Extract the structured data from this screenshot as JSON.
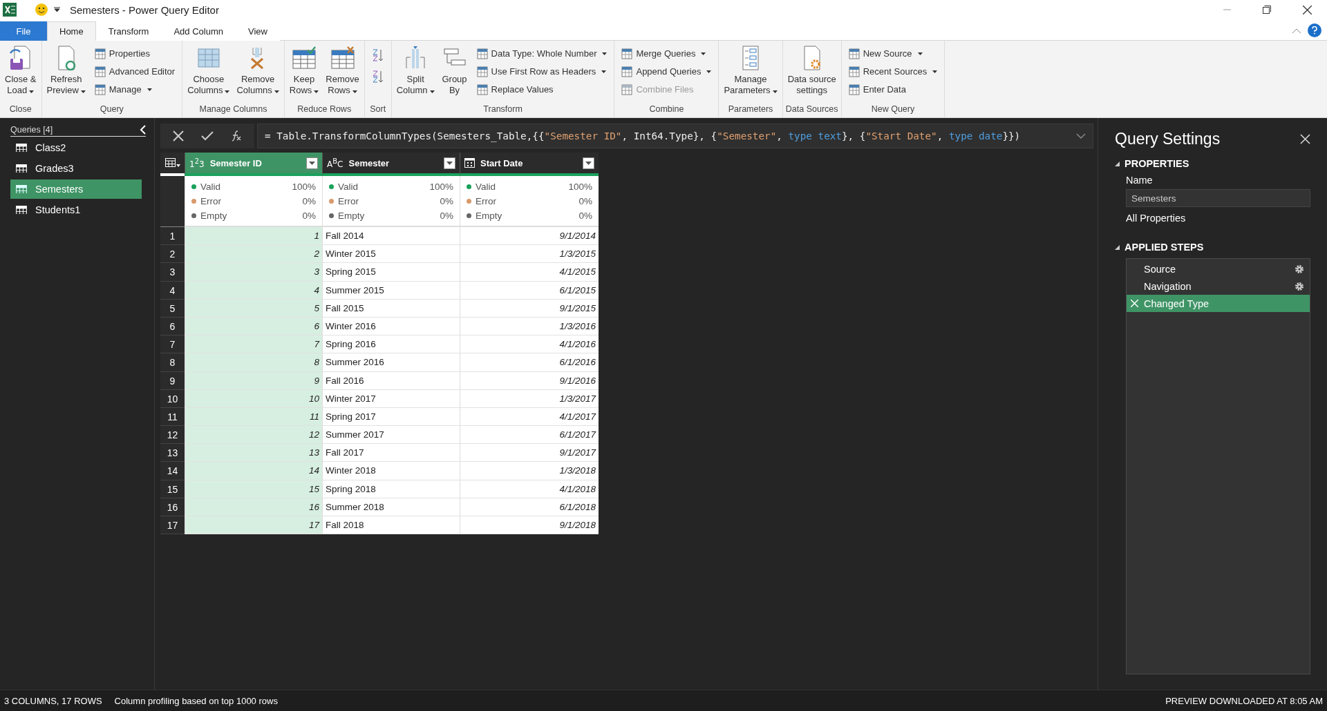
{
  "window": {
    "title": "Semesters - Power Query Editor"
  },
  "tabs": [
    {
      "label": "File",
      "kind": "file",
      "selected": false
    },
    {
      "label": "Home",
      "kind": "tab",
      "selected": true
    },
    {
      "label": "Transform",
      "kind": "tab",
      "selected": false
    },
    {
      "label": "Add Column",
      "kind": "tab",
      "selected": false
    },
    {
      "label": "View",
      "kind": "tab",
      "selected": false
    }
  ],
  "ribbon": {
    "groups": [
      {
        "label": "Close",
        "items": [
          {
            "kind": "large",
            "lines": [
              "Close &",
              "Load"
            ],
            "dropdown": true
          }
        ]
      },
      {
        "label": "Query",
        "items": [
          {
            "kind": "large",
            "lines": [
              "Refresh",
              "Preview"
            ],
            "dropdown": true
          },
          {
            "kind": "stack",
            "entries": [
              {
                "label": "Properties",
                "dropdown": false,
                "disabled": false
              },
              {
                "label": "Advanced Editor",
                "dropdown": false,
                "disabled": false
              },
              {
                "label": "Manage",
                "dropdown": true,
                "disabled": false
              }
            ]
          }
        ]
      },
      {
        "label": "Manage Columns",
        "items": [
          {
            "kind": "large",
            "lines": [
              "Choose",
              "Columns"
            ],
            "dropdown": true
          },
          {
            "kind": "large",
            "lines": [
              "Remove",
              "Columns"
            ],
            "dropdown": true
          }
        ]
      },
      {
        "label": "Reduce Rows",
        "items": [
          {
            "kind": "large",
            "lines": [
              "Keep",
              "Rows"
            ],
            "dropdown": true
          },
          {
            "kind": "large",
            "lines": [
              "Remove",
              "Rows"
            ],
            "dropdown": true
          }
        ]
      },
      {
        "label": "Sort",
        "items": [
          {
            "kind": "sort"
          }
        ]
      },
      {
        "label": "Transform",
        "items": [
          {
            "kind": "large",
            "lines": [
              "Split",
              "Column"
            ],
            "dropdown": true
          },
          {
            "kind": "large",
            "lines": [
              "Group",
              "By"
            ],
            "dropdown": false
          },
          {
            "kind": "stack",
            "entries": [
              {
                "label": "Data Type: Whole Number",
                "dropdown": true,
                "disabled": false
              },
              {
                "label": "Use First Row as Headers",
                "dropdown": true,
                "disabled": false
              },
              {
                "label": "Replace Values",
                "dropdown": false,
                "disabled": false
              }
            ]
          }
        ]
      },
      {
        "label": "Combine",
        "items": [
          {
            "kind": "stack",
            "entries": [
              {
                "label": "Merge Queries",
                "dropdown": true,
                "disabled": false
              },
              {
                "label": "Append Queries",
                "dropdown": true,
                "disabled": false
              },
              {
                "label": "Combine Files",
                "dropdown": false,
                "disabled": true
              }
            ]
          }
        ]
      },
      {
        "label": "Parameters",
        "items": [
          {
            "kind": "large",
            "lines": [
              "Manage",
              "Parameters"
            ],
            "dropdown": true
          }
        ]
      },
      {
        "label": "Data Sources",
        "items": [
          {
            "kind": "large",
            "lines": [
              "Data source",
              "settings"
            ],
            "dropdown": false
          }
        ]
      },
      {
        "label": "New Query",
        "items": [
          {
            "kind": "stack",
            "entries": [
              {
                "label": "New Source",
                "dropdown": true,
                "disabled": false
              },
              {
                "label": "Recent Sources",
                "dropdown": true,
                "disabled": false
              },
              {
                "label": "Enter Data",
                "dropdown": false,
                "disabled": false
              }
            ]
          }
        ]
      }
    ]
  },
  "queries": {
    "title": "Queries [4]",
    "items": [
      {
        "name": "Class2",
        "selected": false
      },
      {
        "name": "Grades3",
        "selected": false
      },
      {
        "name": "Semesters",
        "selected": true
      },
      {
        "name": "Students1",
        "selected": false
      }
    ]
  },
  "formula": [
    {
      "kind": "plain",
      "text": "= Table.TransformColumnTypes(Semesters_Table,{{"
    },
    {
      "kind": "string",
      "text": "\"Semester ID\""
    },
    {
      "kind": "plain",
      "text": ", Int64.Type}, {"
    },
    {
      "kind": "string",
      "text": "\"Semester\""
    },
    {
      "kind": "plain",
      "text": ", "
    },
    {
      "kind": "keyword",
      "text": "type text"
    },
    {
      "kind": "plain",
      "text": "}, {"
    },
    {
      "kind": "string",
      "text": "\"Start Date\""
    },
    {
      "kind": "plain",
      "text": ", "
    },
    {
      "kind": "keyword",
      "text": "type date"
    },
    {
      "kind": "plain",
      "text": "}})"
    }
  ],
  "table": {
    "columns": [
      {
        "name": "Semester ID",
        "kind": "number",
        "type_label": "1$^{2}$3",
        "selected": true,
        "profile": [
          {
            "label": "Valid",
            "value": "100%",
            "color": "#1aa15c"
          },
          {
            "label": "Error",
            "value": "0%",
            "color": "#d89a6a"
          },
          {
            "label": "Empty",
            "value": "0%",
            "color": "#666666"
          }
        ]
      },
      {
        "name": "Semester",
        "kind": "text",
        "type_label": "A$^{B}$C",
        "selected": false,
        "profile": [
          {
            "label": "Valid",
            "value": "100%",
            "color": "#1aa15c"
          },
          {
            "label": "Error",
            "value": "0%",
            "color": "#d89a6a"
          },
          {
            "label": "Empty",
            "value": "0%",
            "color": "#666666"
          }
        ]
      },
      {
        "name": "Start Date",
        "kind": "date",
        "selected": false,
        "profile": [
          {
            "label": "Valid",
            "value": "100%",
            "color": "#1aa15c"
          },
          {
            "label": "Error",
            "value": "0%",
            "color": "#d89a6a"
          },
          {
            "label": "Empty",
            "value": "0%",
            "color": "#666666"
          }
        ]
      }
    ],
    "rows": [
      {
        "number": "1",
        "cells": [
          "1",
          "Fall 2014",
          "9/1/2014"
        ]
      },
      {
        "number": "2",
        "cells": [
          "2",
          "Winter 2015",
          "1/3/2015"
        ]
      },
      {
        "number": "3",
        "cells": [
          "3",
          "Spring 2015",
          "4/1/2015"
        ]
      },
      {
        "number": "4",
        "cells": [
          "4",
          "Summer 2015",
          "6/1/2015"
        ]
      },
      {
        "number": "5",
        "cells": [
          "5",
          "Fall 2015",
          "9/1/2015"
        ]
      },
      {
        "number": "6",
        "cells": [
          "6",
          "Winter 2016",
          "1/3/2016"
        ]
      },
      {
        "number": "7",
        "cells": [
          "7",
          "Spring 2016",
          "4/1/2016"
        ]
      },
      {
        "number": "8",
        "cells": [
          "8",
          "Summer 2016",
          "6/1/2016"
        ]
      },
      {
        "number": "9",
        "cells": [
          "9",
          "Fall 2016",
          "9/1/2016"
        ]
      },
      {
        "number": "10",
        "cells": [
          "10",
          "Winter 2017",
          "1/3/2017"
        ]
      },
      {
        "number": "11",
        "cells": [
          "11",
          "Spring 2017",
          "4/1/2017"
        ]
      },
      {
        "number": "12",
        "cells": [
          "12",
          "Summer 2017",
          "6/1/2017"
        ]
      },
      {
        "number": "13",
        "cells": [
          "13",
          "Fall 2017",
          "9/1/2017"
        ]
      },
      {
        "number": "14",
        "cells": [
          "14",
          "Winter 2018",
          "1/3/2018"
        ]
      },
      {
        "number": "15",
        "cells": [
          "15",
          "Spring 2018",
          "4/1/2018"
        ]
      },
      {
        "number": "16",
        "cells": [
          "16",
          "Summer 2018",
          "6/1/2018"
        ]
      },
      {
        "number": "17",
        "cells": [
          "17",
          "Fall 2018",
          "9/1/2018"
        ]
      }
    ]
  },
  "settings": {
    "title": "Query Settings",
    "properties_heading": "PROPERTIES",
    "name_label": "Name",
    "name_value": "Semesters",
    "all_properties": "All Properties",
    "steps_heading": "APPLIED STEPS",
    "steps": [
      {
        "name": "Source",
        "has_settings": true,
        "selected": false
      },
      {
        "name": "Navigation",
        "has_settings": true,
        "selected": false
      },
      {
        "name": "Changed Type",
        "has_settings": false,
        "selected": true
      }
    ]
  },
  "status_bar": {
    "left": [
      "3 COLUMNS, 17 ROWS",
      "Column profiling based on top 1000 rows"
    ],
    "right": "PREVIEW DOWNLOADED AT 8:05 AM"
  }
}
